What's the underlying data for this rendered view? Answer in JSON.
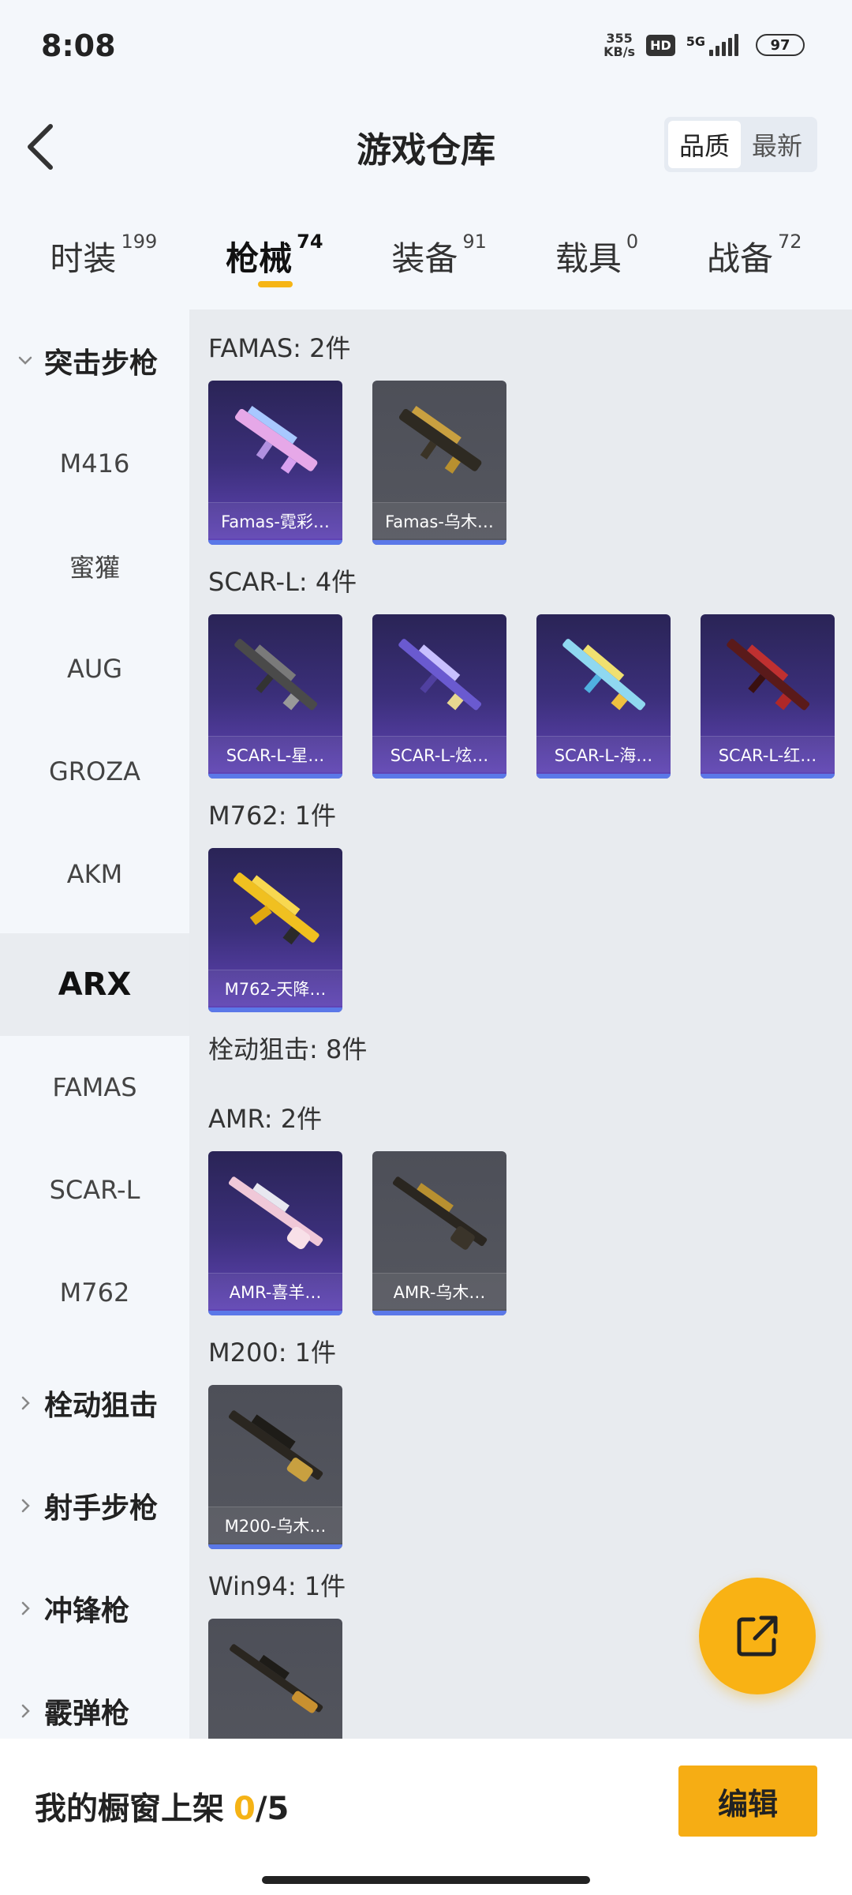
{
  "status": {
    "time": "8:08",
    "net_speed_value": "355",
    "net_speed_unit": "KB/s",
    "hd": "HD",
    "network": "5G",
    "battery": "97"
  },
  "header": {
    "title": "游戏仓库",
    "sort_options": [
      "品质",
      "最新"
    ]
  },
  "tabs": [
    {
      "label": "时装",
      "count": "199"
    },
    {
      "label": "枪械",
      "count": "74",
      "active": true
    },
    {
      "label": "装备",
      "count": "91"
    },
    {
      "label": "载具",
      "count": "0"
    },
    {
      "label": "战备",
      "count": "72"
    }
  ],
  "sidebar": {
    "items": [
      {
        "label": "突击步枪",
        "type": "group-expanded"
      },
      {
        "label": "M416"
      },
      {
        "label": "蜜獾"
      },
      {
        "label": "AUG"
      },
      {
        "label": "GROZA"
      },
      {
        "label": "AKM"
      },
      {
        "label": "ARX",
        "active": true
      },
      {
        "label": "FAMAS"
      },
      {
        "label": "SCAR-L"
      },
      {
        "label": "M762"
      },
      {
        "label": "栓动狙击",
        "type": "group-collapsed"
      },
      {
        "label": "射手步枪",
        "type": "group-collapsed"
      },
      {
        "label": "冲锋枪",
        "type": "group-collapsed"
      },
      {
        "label": "霰弹枪",
        "type": "group-collapsed"
      }
    ]
  },
  "sections": [
    {
      "title": "FAMAS: 2件",
      "items": [
        "Famas-霓彩…",
        "Famas-乌木…"
      ]
    },
    {
      "title": "SCAR-L: 4件",
      "items": [
        "SCAR-L-星…",
        "SCAR-L-炫…",
        "SCAR-L-海…",
        "SCAR-L-红…"
      ]
    },
    {
      "title": "M762: 1件",
      "items": [
        "M762-天降…"
      ]
    },
    {
      "title": "栓动狙击: 8件",
      "items": []
    },
    {
      "title": "AMR: 2件",
      "items": [
        "AMR-喜羊…",
        "AMR-乌木…"
      ]
    },
    {
      "title": "M200: 1件",
      "items": [
        "M200-乌木…"
      ]
    },
    {
      "title": "Win94: 1件",
      "items": [
        ""
      ]
    }
  ],
  "bottom": {
    "showcase_label": "我的橱窗上架",
    "used": "0",
    "slash": "/",
    "total": "5",
    "edit_label": "编辑"
  },
  "colors": {
    "accent": "#f6ad14",
    "purple_card": "#3b2f7a",
    "gray_card": "#55575f",
    "rarity_stripe": "#5b78e8"
  }
}
